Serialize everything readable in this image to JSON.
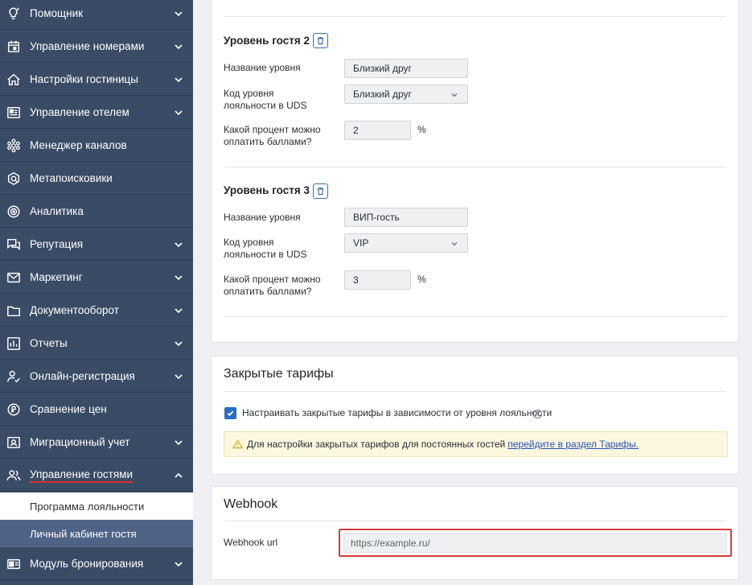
{
  "sidebar": {
    "items": [
      {
        "label": "Помощник",
        "icon": "lightbulb-icon",
        "chevron": "down"
      },
      {
        "label": "Управление номерами",
        "icon": "calendar-icon",
        "chevron": "down"
      },
      {
        "label": "Настройки гостиницы",
        "icon": "home-icon",
        "chevron": "down"
      },
      {
        "label": "Управление отелем",
        "icon": "newspaper-icon",
        "chevron": "down"
      },
      {
        "label": "Менеджер каналов",
        "icon": "hub-icon",
        "chevron": ""
      },
      {
        "label": "Метапоисковики",
        "icon": "meta-search-icon",
        "chevron": ""
      },
      {
        "label": "Аналитика",
        "icon": "target-icon",
        "chevron": ""
      },
      {
        "label": "Репутация",
        "icon": "chat-icon",
        "chevron": "down"
      },
      {
        "label": "Маркетинг",
        "icon": "mail-icon",
        "chevron": "down"
      },
      {
        "label": "Документооборот",
        "icon": "folder-icon",
        "chevron": "down"
      },
      {
        "label": "Отчеты",
        "icon": "bar-chart-icon",
        "chevron": "down"
      },
      {
        "label": "Онлайн-регистрация",
        "icon": "person-check-icon",
        "chevron": "down"
      },
      {
        "label": "Сравнение цен",
        "icon": "price-compare-icon",
        "chevron": ""
      },
      {
        "label": "Миграционный учет",
        "icon": "id-card-icon",
        "chevron": "down"
      },
      {
        "label": "Управление гостями",
        "icon": "people-icon",
        "chevron": "up"
      }
    ],
    "sub_items": [
      "Программа лояльности",
      "Личный кабинет гостя"
    ],
    "bottom_item": {
      "label": "Модуль бронирования",
      "icon": "booking-module-icon",
      "chevron": "down"
    }
  },
  "levels": [
    {
      "title": "Уровень гостя 2",
      "name_label": "Название уровня",
      "name_value": "Близкий друг",
      "code_label": "Код уровня лояльности в UDS",
      "code_value": "Близкий друг",
      "percent_label": "Какой процент можно оплатить баллами?",
      "percent_value": "2",
      "percent_unit": "%"
    },
    {
      "title": "Уровень гостя 3",
      "name_label": "Название уровня",
      "name_value": "ВИП-гость",
      "code_label": "Код уровня лояльности в UDS",
      "code_value": "VIP",
      "percent_label": "Какой процент можно оплатить баллами?",
      "percent_value": "3",
      "percent_unit": "%"
    }
  ],
  "tariffs": {
    "title": "Закрытые тарифы",
    "checkbox_label": "Настраивать закрытые тарифы в зависимости от уровня лояльности",
    "checked": true,
    "help_glyph": "?",
    "warning_text": "Для настройки закрытых тарифов для постоянных гостей",
    "warning_link": "перейдите в раздел Тарифы."
  },
  "webhook": {
    "title": "Webhook",
    "url_label": "Webhook url",
    "url_placeholder": "https://example.ru/"
  },
  "colors": {
    "sidebar_bg": "#3a4b66",
    "active_sub_bg": "#4f6386",
    "accent_blue": "#2b6cc4",
    "highlight_red": "#d33c3c"
  }
}
